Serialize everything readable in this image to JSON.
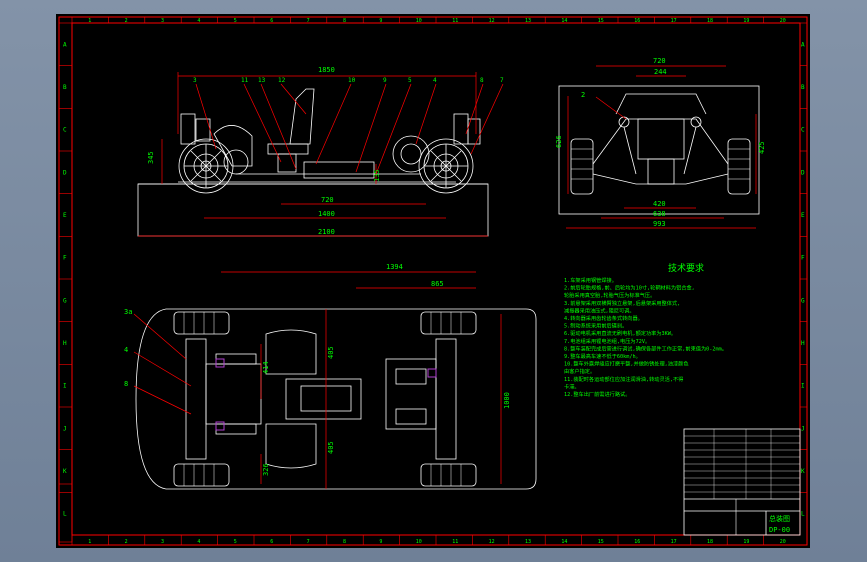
{
  "colors": {
    "frame": "#ff0000",
    "outline": "#ffffff",
    "dim": "#ff0000",
    "text": "#00ff00",
    "lead": "#ff0000",
    "part": "#d8d8d8",
    "accent": "#b040d0"
  },
  "border": {
    "cols": [
      "1",
      "2",
      "3",
      "4",
      "5",
      "6",
      "7",
      "8",
      "9",
      "10",
      "11",
      "12",
      "13",
      "14",
      "15",
      "16",
      "17",
      "18",
      "19",
      "20"
    ],
    "rows": [
      "A",
      "B",
      "C",
      "D",
      "E",
      "F",
      "G",
      "H",
      "I",
      "J",
      "K",
      "L"
    ]
  },
  "side_view": {
    "dims": {
      "overall": "1850",
      "wheelbase_partial": "720",
      "bottom_a": "1400",
      "bottom_b": "2100",
      "height_left": "345",
      "height_small": "135"
    },
    "balloons": [
      "3",
      "11",
      "13",
      "12",
      "10",
      "9",
      "5",
      "4",
      "8",
      "7"
    ]
  },
  "front_view": {
    "dims": {
      "top": "720",
      "inner": "244",
      "height_left": "626",
      "height_right": "425",
      "b1": "420",
      "b2": "638",
      "b3": "993"
    },
    "balloons": [
      "2"
    ]
  },
  "plan_view": {
    "dims": {
      "long": "1394",
      "mid": "865",
      "h1": "405",
      "h2": "405",
      "small1": "414",
      "small2": "326",
      "right": "1000"
    },
    "balloons": [
      "3a",
      "4",
      "8"
    ]
  },
  "notes": {
    "title": "技术要求",
    "lines": [
      "1.车架采用钢管焊接。",
      "2.前后轮胎规格,前、后轮均为10寸,轮辋材料为铝合金,",
      "  轮胎采用真空胎,轮胎气压为标准气压。",
      "3.前悬架采用双横臂独立悬架,后悬架采用整体式,",
      "  减振器采用油压式,阻尼可调。",
      "4.转向器采用齿轮齿条式转向器。",
      "5.制动系统采用前后碟刹。",
      "6.驱动电机采用直流无刷电机,额定功率为3KW。",
      "7.电池组采用锂电池组,电压为72V。",
      "8.整车装配完成后需进行调试,确保各部件工作正常,前束值为0-2mm。",
      "9.整车最高车速不低于60km/h。",
      "10.整车外露焊缝应打磨平整,并做防锈处理,油漆颜色",
      "   由客户指定。",
      "11.装配时各运动部位应加注润滑油,转动灵活,不得",
      "   卡滞。",
      "12.整车出厂前需进行路试。"
    ]
  },
  "title_block": {
    "drawing_no": "DP-00",
    "name": "总装图"
  }
}
